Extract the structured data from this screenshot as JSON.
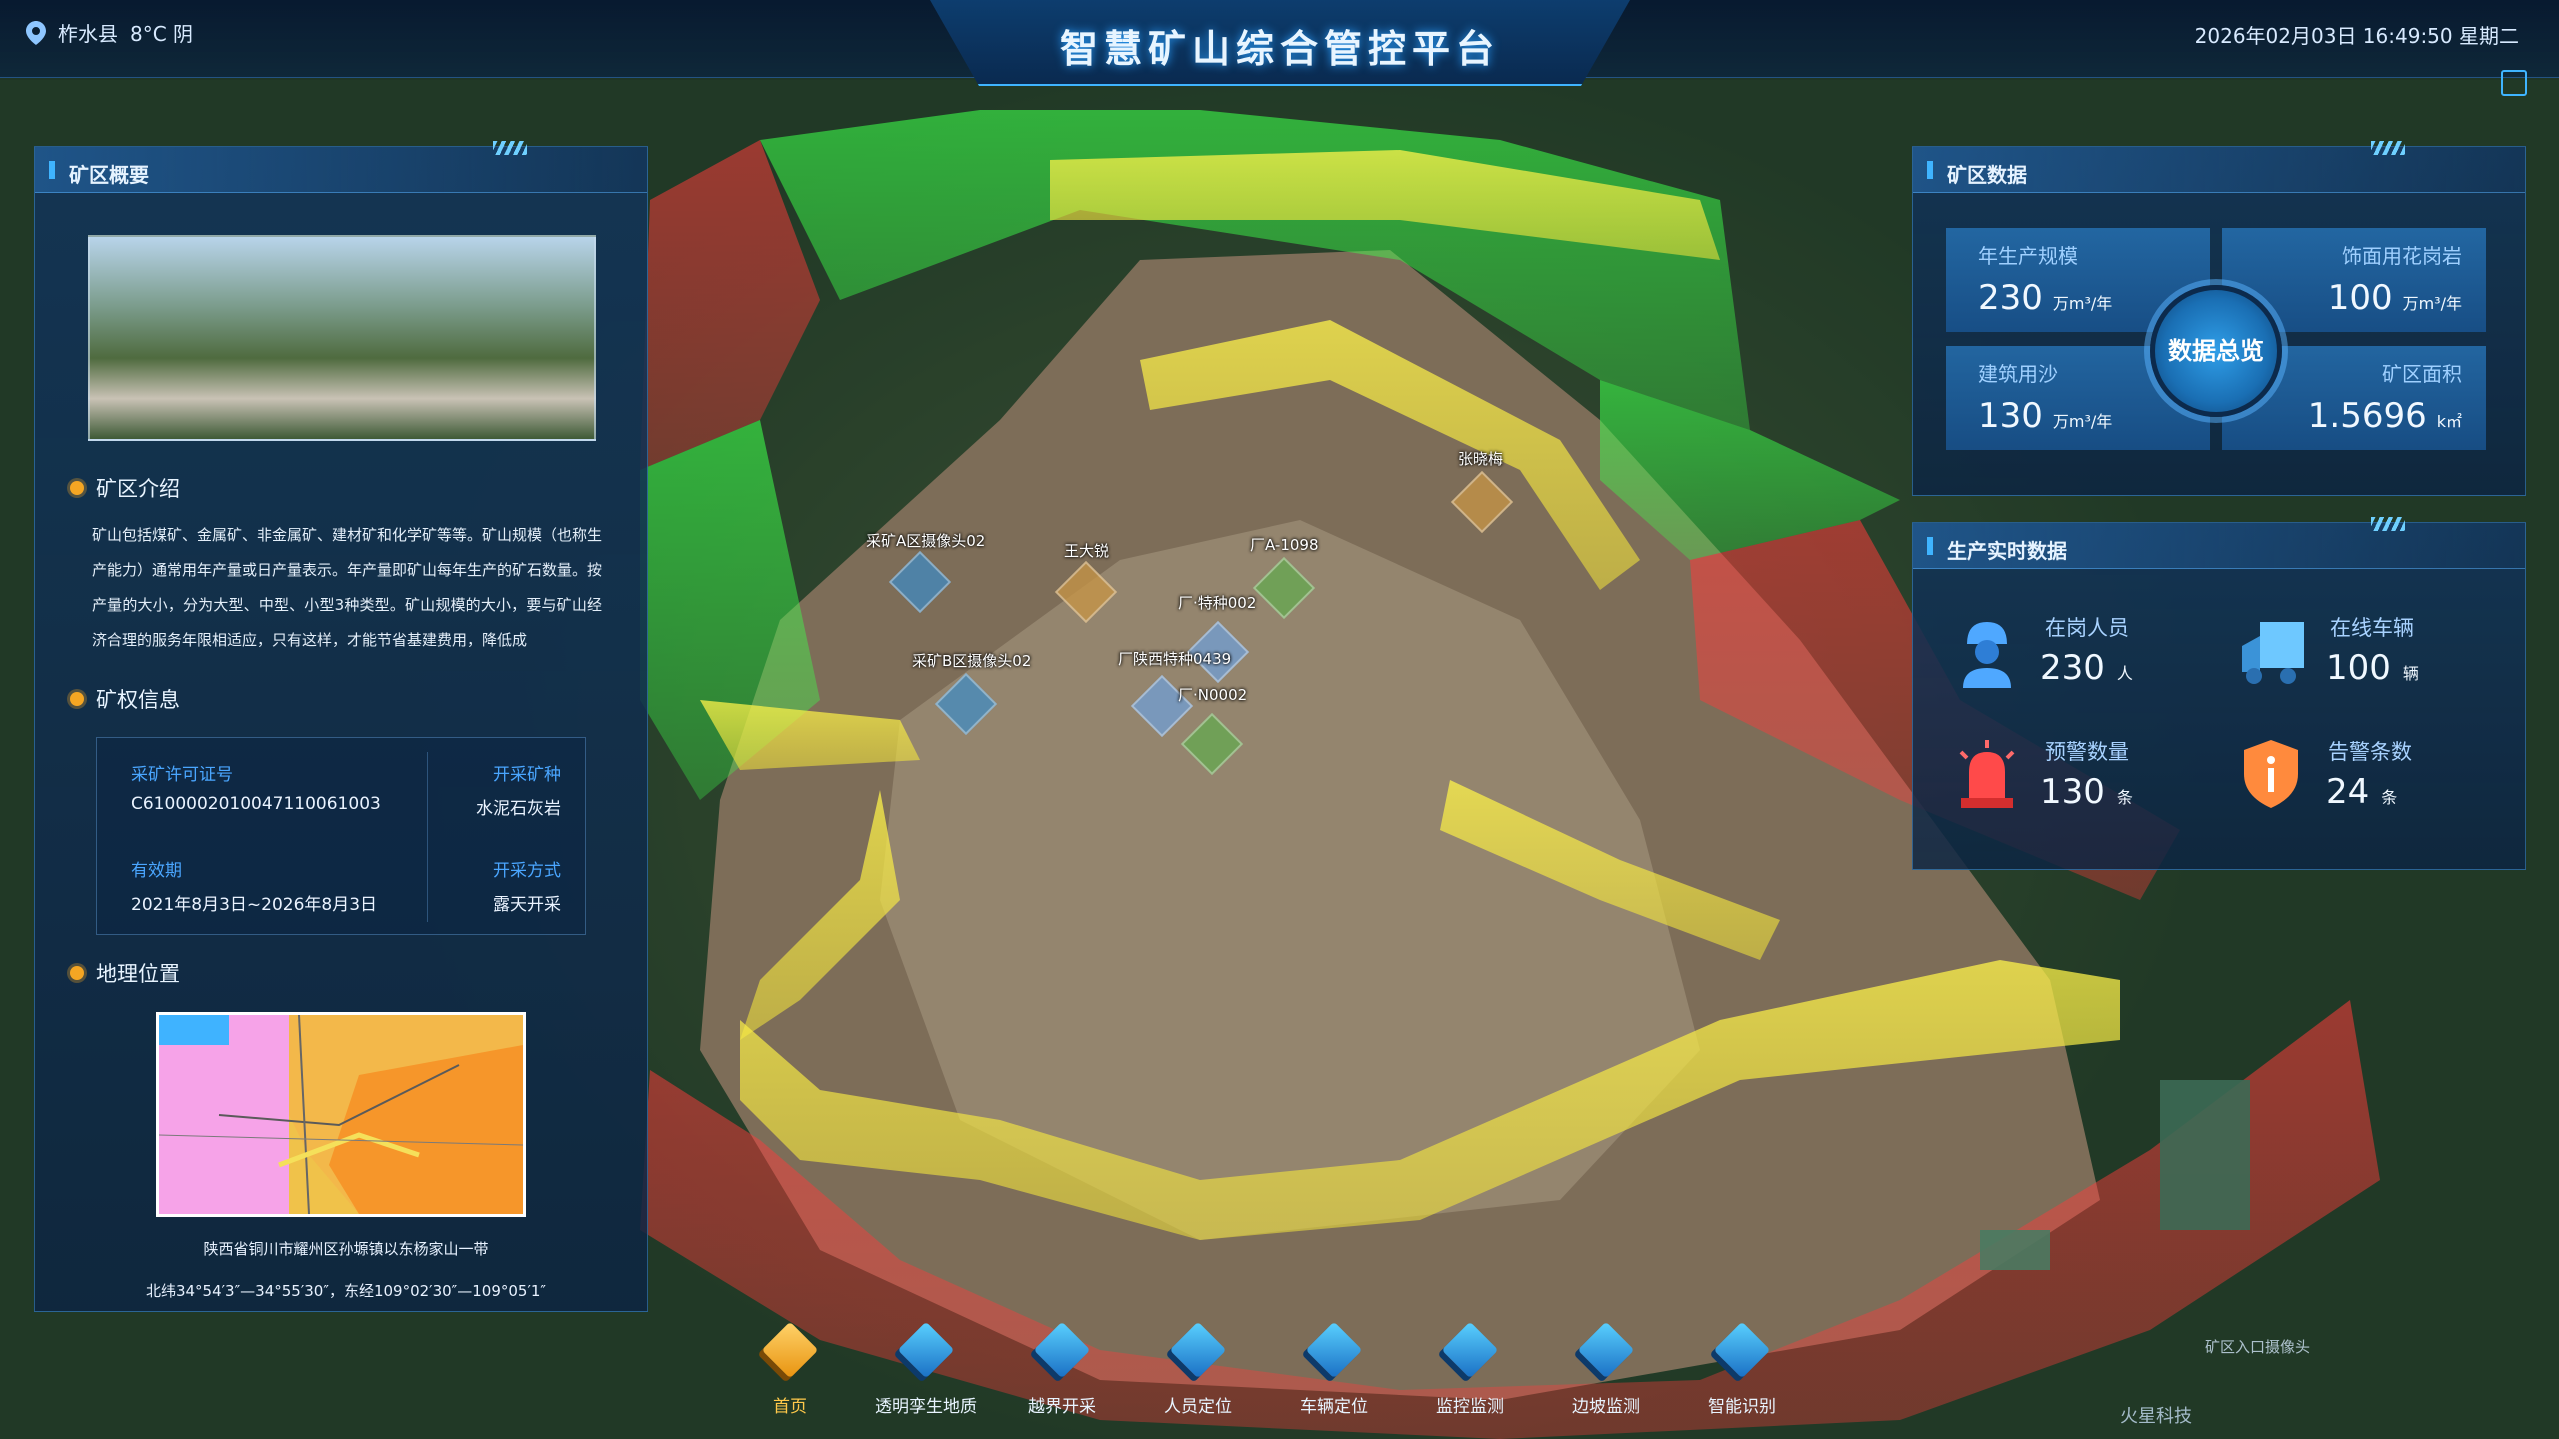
{
  "header": {
    "title": "智慧矿山综合管控平台",
    "location": "柞水县",
    "weather": "8°C 阴",
    "datetime": "2026年02月03日 16:49:50 星期二"
  },
  "left_panel": {
    "title": "矿区概要",
    "intro": {
      "heading": "矿区介绍",
      "text": "矿山包括煤矿、金属矿、非金属矿、建材矿和化学矿等等。矿山规模（也称生产能力）通常用年产量或日产量表示。年产量即矿山每年生产的矿石数量。按产量的大小，分为大型、中型、小型3种类型。矿山规模的大小，要与矿山经济合理的服务年限相适应，只有这样，才能节省基建费用，降低成"
    },
    "rights": {
      "heading": "矿权信息",
      "license_label": "采矿许可证号",
      "license_value": "C6100002010047110061003",
      "mineral_label": "开采矿种",
      "mineral_value": "水泥石灰岩",
      "validity_label": "有效期",
      "validity_value": "2021年8月3日~2026年8月3日",
      "method_label": "开采方式",
      "method_value": "露天开采"
    },
    "location": {
      "heading": "地理位置",
      "address": "陕西省铜川市耀州区孙塬镇以东杨家山一带",
      "coords": "北纬34°54′3″—34°55′30″，东经109°02′30″—109°05′1″"
    }
  },
  "right_panel": {
    "mine_data_title": "矿区数据",
    "hub_label": "数据总览",
    "stats": [
      {
        "label": "年生产规模",
        "value": "230",
        "unit": "万m³/年"
      },
      {
        "label": "饰面用花岗岩",
        "value": "100",
        "unit": "万m³/年"
      },
      {
        "label": "建筑用沙",
        "value": "130",
        "unit": "万m³/年"
      },
      {
        "label": "矿区面积",
        "value": "1.5696",
        "unit": "k㎡"
      }
    ],
    "realtime_title": "生产实时数据",
    "realtime": [
      {
        "label": "在岗人员",
        "value": "230",
        "unit": "人",
        "icon": "worker-icon",
        "color": "#4fa8ff"
      },
      {
        "label": "在线车辆",
        "value": "100",
        "unit": "辆",
        "icon": "truck-icon",
        "color": "#6ec8ff"
      },
      {
        "label": "预警数量",
        "value": "130",
        "unit": "条",
        "icon": "alarm-light-icon",
        "color": "#ff4a4a"
      },
      {
        "label": "告警条数",
        "value": "24",
        "unit": "条",
        "icon": "shield-icon",
        "color": "#ff8a3d"
      }
    ]
  },
  "map_markers": [
    {
      "label": "采矿A区摄像头02",
      "kind": "camera"
    },
    {
      "label": "王大锐",
      "kind": "person"
    },
    {
      "label": "厂A-1098",
      "kind": "vehicle"
    },
    {
      "label": "张晓梅",
      "kind": "person"
    },
    {
      "label": "厂·特种002",
      "kind": "vehicle"
    },
    {
      "label": "采矿B区摄像头02",
      "kind": "camera"
    },
    {
      "label": "厂陕西特种0439",
      "kind": "vehicle"
    },
    {
      "label": "厂·N0002",
      "kind": "vehicle"
    },
    {
      "label": "矿区入口摄像头",
      "kind": "camera"
    }
  ],
  "nav": [
    {
      "label": "首页",
      "active": true
    },
    {
      "label": "透明孪生地质"
    },
    {
      "label": "越界开采"
    },
    {
      "label": "人员定位"
    },
    {
      "label": "车辆定位"
    },
    {
      "label": "监控监测"
    },
    {
      "label": "边坡监测"
    },
    {
      "label": "智能识别"
    }
  ],
  "brand": "火星科技"
}
